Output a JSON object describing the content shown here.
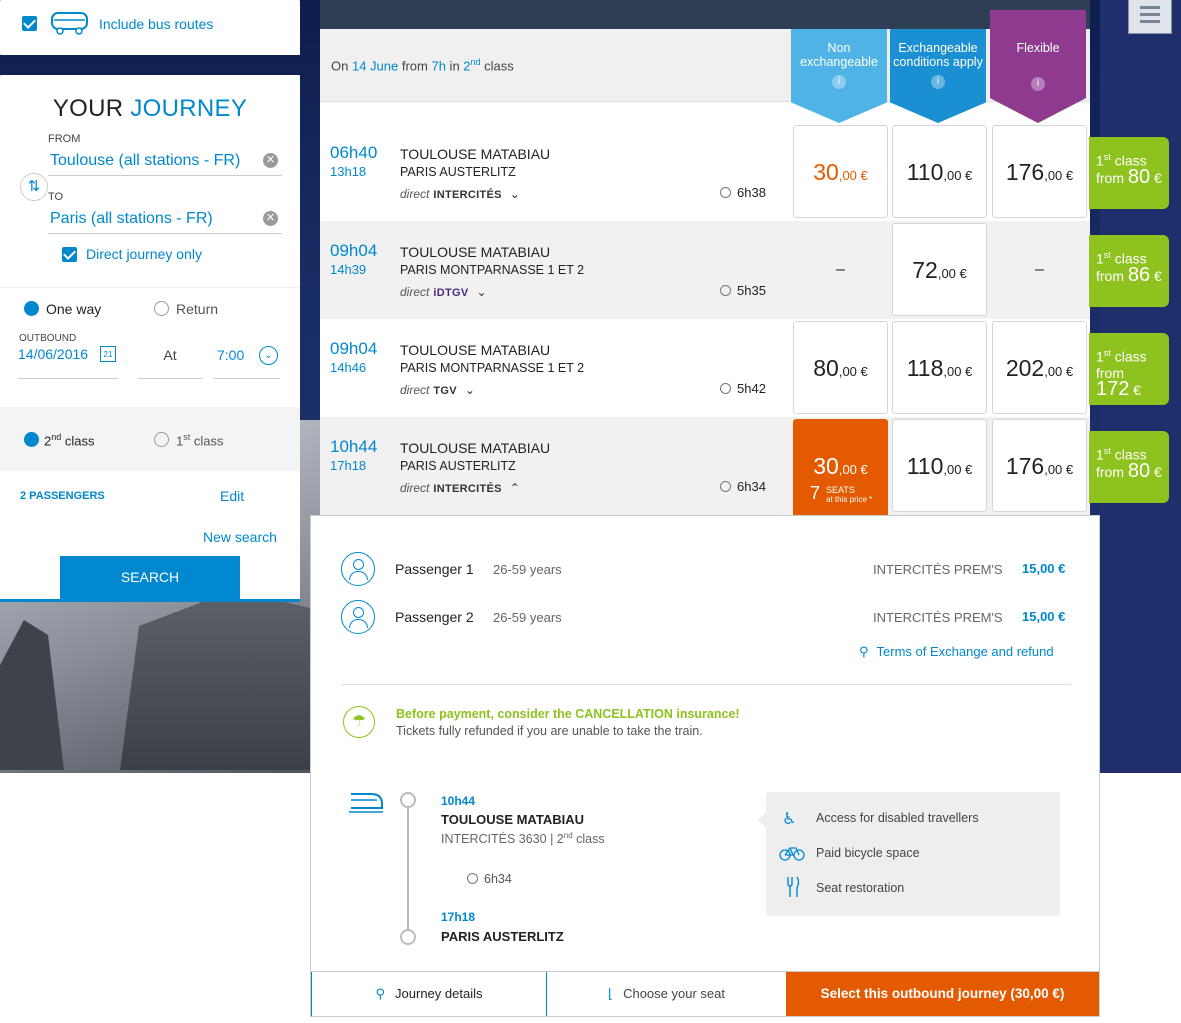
{
  "sidebar": {
    "bus_label": "Include bus routes",
    "title_a": "YOUR",
    "title_b": "JOURNEY",
    "from_label": "FROM",
    "from_value": "Toulouse (all stations - FR)",
    "to_label": "TO",
    "to_value": "Paris (all stations - FR)",
    "direct_label": "Direct journey only",
    "one_way": "One way",
    "return": "Return",
    "outbound_label": "OUTBOUND",
    "outbound_date": "14/06/2016",
    "at_label": "At",
    "time": "7:00",
    "class2": "2",
    "class2_sup": "nd",
    "class2_word": " class",
    "class1": "1",
    "class1_sup": "st",
    "class1_word": " class",
    "passengers": "2 PASSENGERS",
    "edit": "Edit",
    "new_search": "New search",
    "search": "SEARCH",
    "calendar_day": "21"
  },
  "results": {
    "date_prefix": "On ",
    "date": "14 June",
    "from_word": " from ",
    "time": "7h",
    "in_word": " in ",
    "class_num": "2",
    "class_sup": "nd",
    "class_word": " class",
    "columns": [
      {
        "label": "Non exchangeable",
        "color": "#4fb3e6"
      },
      {
        "label": "Exchangeable conditions apply",
        "color": "#1a8fd1"
      },
      {
        "label": "Flexible",
        "color": "#8e3a8f"
      }
    ],
    "rows": [
      {
        "dep": "06h40",
        "arr": "13h18",
        "st1": "TOULOUSE MATABIAU",
        "st2": "PARIS AUSTERLITZ",
        "direct": "direct",
        "train": "INTERCITÉS",
        "dur": "6h38",
        "p1": "30",
        "p2": "110",
        "p3": "176",
        "cents": ",00 €",
        "first_a": "1",
        "first_sup": "st",
        "first_b": " class",
        "first_from": "from ",
        "first_val": "80",
        "first_cur": " €"
      },
      {
        "dep": "09h04",
        "arr": "14h39",
        "st1": "TOULOUSE MATABIAU",
        "st2": "PARIS MONTPARNASSE 1 ET 2",
        "direct": "direct",
        "train": "iDTGV",
        "dur": "5h35",
        "p1": "–",
        "p2": "72",
        "p3": "–",
        "cents": ",00 €",
        "first_a": "1",
        "first_sup": "st",
        "first_b": " class",
        "first_from": "from ",
        "first_val": "86",
        "first_cur": " €"
      },
      {
        "dep": "09h04",
        "arr": "14h46",
        "st1": "TOULOUSE MATABIAU",
        "st2": "PARIS MONTPARNASSE 1 ET 2",
        "direct": "direct",
        "train": "TGV",
        "dur": "5h42",
        "p1": "80",
        "p2": "118",
        "p3": "202",
        "cents": ",00 €",
        "first_a": "1",
        "first_sup": "st",
        "first_b": " class",
        "first_from": "from",
        "first_val": "172",
        "first_cur": " €"
      },
      {
        "dep": "10h44",
        "arr": "17h18",
        "st1": "TOULOUSE MATABIAU",
        "st2": "PARIS AUSTERLITZ",
        "direct": "direct",
        "train": "INTERCITÉS",
        "dur": "6h34",
        "p1": "30",
        "p2": "110",
        "p3": "176",
        "cents": ",00 €",
        "first_a": "1",
        "first_sup": "st",
        "first_b": " class",
        "first_from": "from ",
        "first_val": "80",
        "first_cur": " €",
        "seats_num": "7",
        "seats_word": "SEATS",
        "seats_sub": "at this price *"
      }
    ]
  },
  "detail": {
    "passengers": [
      {
        "name": "Passenger 1",
        "age": "26-59 years",
        "fare": "INTERCITÉS PREM'S",
        "price": "15,00 €"
      },
      {
        "name": "Passenger 2",
        "age": "26-59 years",
        "fare": "INTERCITÉS PREM'S",
        "price": "15,00 €"
      }
    ],
    "terms": "Terms of Exchange and refund",
    "insurance_title": "Before payment, consider the CANCELLATION insurance!",
    "insurance_sub": "Tickets fully refunded if you are unable to take the train.",
    "dep_time": "10h44",
    "dep_station": "TOULOUSE MATABIAU",
    "train_info": "INTERCITÉS 3630 | 2",
    "train_sup": "nd",
    "train_class": " class",
    "duration": "6h34",
    "arr_time": "17h18",
    "arr_station": "PARIS AUSTERLITZ",
    "services": [
      "Access for disabled travellers",
      "Paid bicycle space",
      "Seat restoration"
    ],
    "buttons": {
      "details": "Journey details",
      "seat": "Choose your seat",
      "select": "Select this outbound journey (30,00 €)"
    }
  },
  "colors": {
    "accent": "#0088ce",
    "orange": "#e35a00",
    "green": "#8dc21f",
    "purple": "#8e3a8f"
  }
}
